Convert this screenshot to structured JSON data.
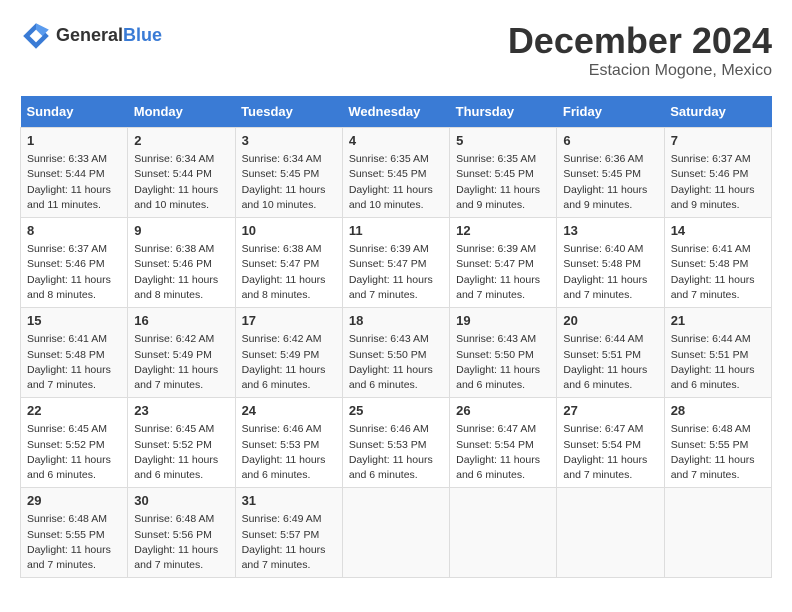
{
  "header": {
    "logo_general": "General",
    "logo_blue": "Blue",
    "month_title": "December 2024",
    "location": "Estacion Mogone, Mexico"
  },
  "weekdays": [
    "Sunday",
    "Monday",
    "Tuesday",
    "Wednesday",
    "Thursday",
    "Friday",
    "Saturday"
  ],
  "weeks": [
    [
      {
        "day": "1",
        "info": "Sunrise: 6:33 AM\nSunset: 5:44 PM\nDaylight: 11 hours and 11 minutes."
      },
      {
        "day": "2",
        "info": "Sunrise: 6:34 AM\nSunset: 5:44 PM\nDaylight: 11 hours and 10 minutes."
      },
      {
        "day": "3",
        "info": "Sunrise: 6:34 AM\nSunset: 5:45 PM\nDaylight: 11 hours and 10 minutes."
      },
      {
        "day": "4",
        "info": "Sunrise: 6:35 AM\nSunset: 5:45 PM\nDaylight: 11 hours and 10 minutes."
      },
      {
        "day": "5",
        "info": "Sunrise: 6:35 AM\nSunset: 5:45 PM\nDaylight: 11 hours and 9 minutes."
      },
      {
        "day": "6",
        "info": "Sunrise: 6:36 AM\nSunset: 5:45 PM\nDaylight: 11 hours and 9 minutes."
      },
      {
        "day": "7",
        "info": "Sunrise: 6:37 AM\nSunset: 5:46 PM\nDaylight: 11 hours and 9 minutes."
      }
    ],
    [
      {
        "day": "8",
        "info": "Sunrise: 6:37 AM\nSunset: 5:46 PM\nDaylight: 11 hours and 8 minutes."
      },
      {
        "day": "9",
        "info": "Sunrise: 6:38 AM\nSunset: 5:46 PM\nDaylight: 11 hours and 8 minutes."
      },
      {
        "day": "10",
        "info": "Sunrise: 6:38 AM\nSunset: 5:47 PM\nDaylight: 11 hours and 8 minutes."
      },
      {
        "day": "11",
        "info": "Sunrise: 6:39 AM\nSunset: 5:47 PM\nDaylight: 11 hours and 7 minutes."
      },
      {
        "day": "12",
        "info": "Sunrise: 6:39 AM\nSunset: 5:47 PM\nDaylight: 11 hours and 7 minutes."
      },
      {
        "day": "13",
        "info": "Sunrise: 6:40 AM\nSunset: 5:48 PM\nDaylight: 11 hours and 7 minutes."
      },
      {
        "day": "14",
        "info": "Sunrise: 6:41 AM\nSunset: 5:48 PM\nDaylight: 11 hours and 7 minutes."
      }
    ],
    [
      {
        "day": "15",
        "info": "Sunrise: 6:41 AM\nSunset: 5:48 PM\nDaylight: 11 hours and 7 minutes."
      },
      {
        "day": "16",
        "info": "Sunrise: 6:42 AM\nSunset: 5:49 PM\nDaylight: 11 hours and 7 minutes."
      },
      {
        "day": "17",
        "info": "Sunrise: 6:42 AM\nSunset: 5:49 PM\nDaylight: 11 hours and 6 minutes."
      },
      {
        "day": "18",
        "info": "Sunrise: 6:43 AM\nSunset: 5:50 PM\nDaylight: 11 hours and 6 minutes."
      },
      {
        "day": "19",
        "info": "Sunrise: 6:43 AM\nSunset: 5:50 PM\nDaylight: 11 hours and 6 minutes."
      },
      {
        "day": "20",
        "info": "Sunrise: 6:44 AM\nSunset: 5:51 PM\nDaylight: 11 hours and 6 minutes."
      },
      {
        "day": "21",
        "info": "Sunrise: 6:44 AM\nSunset: 5:51 PM\nDaylight: 11 hours and 6 minutes."
      }
    ],
    [
      {
        "day": "22",
        "info": "Sunrise: 6:45 AM\nSunset: 5:52 PM\nDaylight: 11 hours and 6 minutes."
      },
      {
        "day": "23",
        "info": "Sunrise: 6:45 AM\nSunset: 5:52 PM\nDaylight: 11 hours and 6 minutes."
      },
      {
        "day": "24",
        "info": "Sunrise: 6:46 AM\nSunset: 5:53 PM\nDaylight: 11 hours and 6 minutes."
      },
      {
        "day": "25",
        "info": "Sunrise: 6:46 AM\nSunset: 5:53 PM\nDaylight: 11 hours and 6 minutes."
      },
      {
        "day": "26",
        "info": "Sunrise: 6:47 AM\nSunset: 5:54 PM\nDaylight: 11 hours and 6 minutes."
      },
      {
        "day": "27",
        "info": "Sunrise: 6:47 AM\nSunset: 5:54 PM\nDaylight: 11 hours and 7 minutes."
      },
      {
        "day": "28",
        "info": "Sunrise: 6:48 AM\nSunset: 5:55 PM\nDaylight: 11 hours and 7 minutes."
      }
    ],
    [
      {
        "day": "29",
        "info": "Sunrise: 6:48 AM\nSunset: 5:55 PM\nDaylight: 11 hours and 7 minutes."
      },
      {
        "day": "30",
        "info": "Sunrise: 6:48 AM\nSunset: 5:56 PM\nDaylight: 11 hours and 7 minutes."
      },
      {
        "day": "31",
        "info": "Sunrise: 6:49 AM\nSunset: 5:57 PM\nDaylight: 11 hours and 7 minutes."
      },
      {
        "day": "",
        "info": ""
      },
      {
        "day": "",
        "info": ""
      },
      {
        "day": "",
        "info": ""
      },
      {
        "day": "",
        "info": ""
      }
    ]
  ]
}
